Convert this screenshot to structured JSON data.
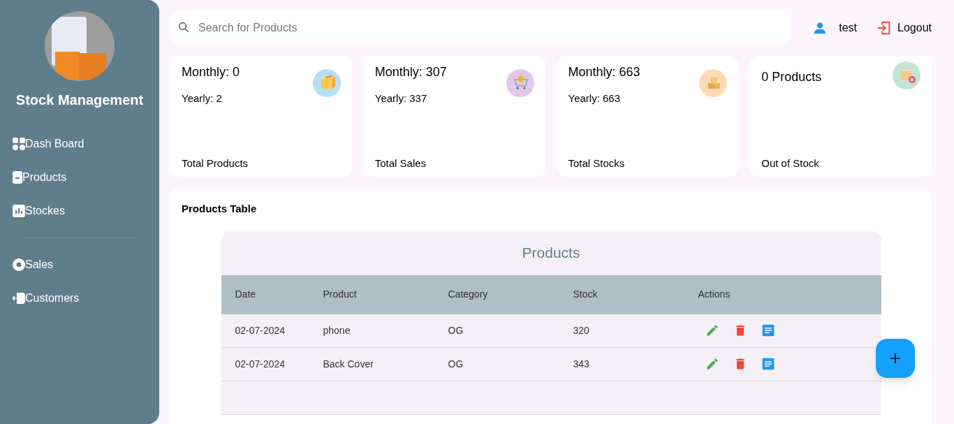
{
  "sidebar": {
    "title": "Stock Management",
    "nav_groups": [
      [
        {
          "label": "Dash Board"
        },
        {
          "label": "Products"
        },
        {
          "label": "Stockes"
        }
      ],
      [
        {
          "label": "Sales"
        },
        {
          "label": "Customers"
        }
      ]
    ]
  },
  "search": {
    "placeholder": "Search for Products"
  },
  "user": {
    "name": "test",
    "logout": "Logout"
  },
  "cards": [
    {
      "kind": "stats",
      "monthly": "Monthly: 0",
      "yearly": "Yearly: 2",
      "label": "Total Products",
      "color": "#b3e0f9"
    },
    {
      "kind": "stats",
      "monthly": "Monthly: 307",
      "yearly": "Yearly: 337",
      "label": "Total Sales",
      "color": "#e1c8e6"
    },
    {
      "kind": "stats",
      "monthly": "Monthly: 663",
      "yearly": "Yearly: 663",
      "label": "Total Stocks",
      "color": "#fddcb5"
    },
    {
      "kind": "count",
      "headline": "0 Products",
      "label": "Out of Stock",
      "color": "#c2e6d6"
    }
  ],
  "panel": {
    "title": "Products Table",
    "table": {
      "title": "Products",
      "columns": [
        "Date",
        "Product",
        "Category",
        "Stock",
        "Actions"
      ],
      "rows": [
        {
          "cells": [
            "02-07-2024",
            "phone",
            "OG",
            "320"
          ]
        },
        {
          "cells": [
            "02-07-2024",
            "Back Cover",
            "OG",
            "343"
          ]
        }
      ]
    }
  }
}
